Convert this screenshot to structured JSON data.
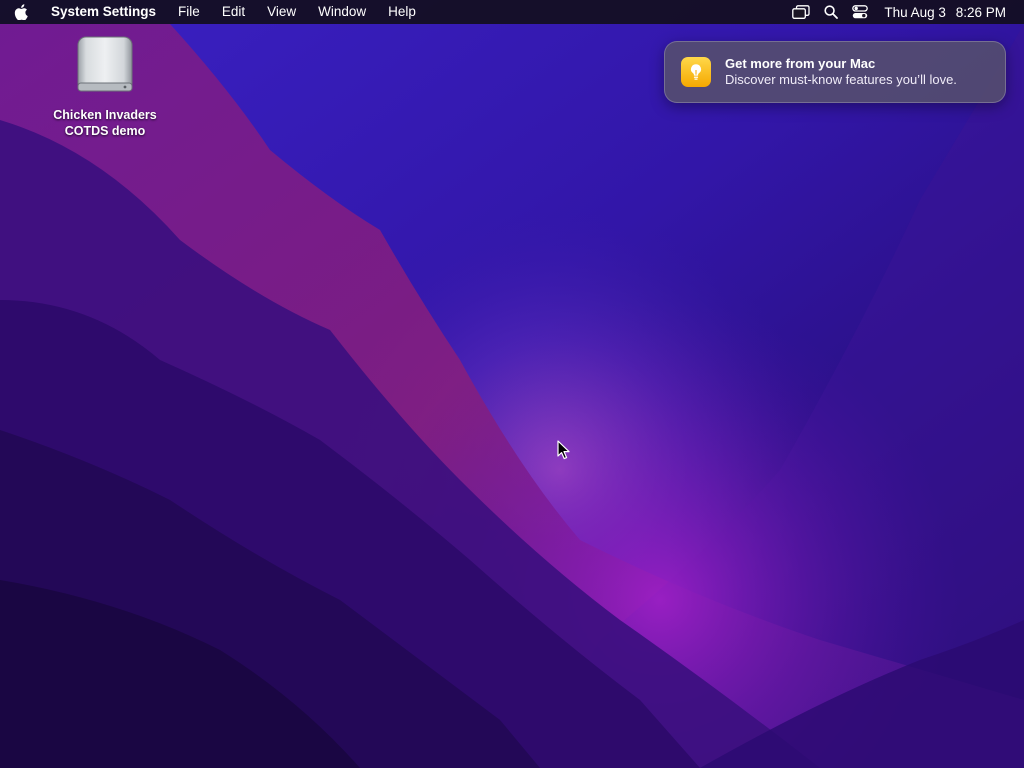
{
  "menubar": {
    "apple_icon": "apple-logo-icon",
    "app_name": "System Settings",
    "menus": [
      "File",
      "Edit",
      "View",
      "Window",
      "Help"
    ],
    "status_icons": [
      "screen-mirroring-icon",
      "spotlight-search-icon",
      "control-center-icon"
    ],
    "date": "Thu Aug 3",
    "time": "8:26 PM"
  },
  "desktop": {
    "drive": {
      "icon": "external-drive-icon",
      "label_line1": "Chicken Invaders",
      "label_line2": "COTDS demo"
    }
  },
  "notification": {
    "icon": "tips-lightbulb-icon",
    "title": "Get more from your Mac",
    "body": "Discover must-know features you’ll love."
  },
  "colors": {
    "menubar_bg": "#120e1e",
    "wallpaper_dark": "#1e0850",
    "wallpaper_purple": "#8a1bb5",
    "wallpaper_blue": "#4a2fd6",
    "notification_icon": "#f5b800"
  }
}
